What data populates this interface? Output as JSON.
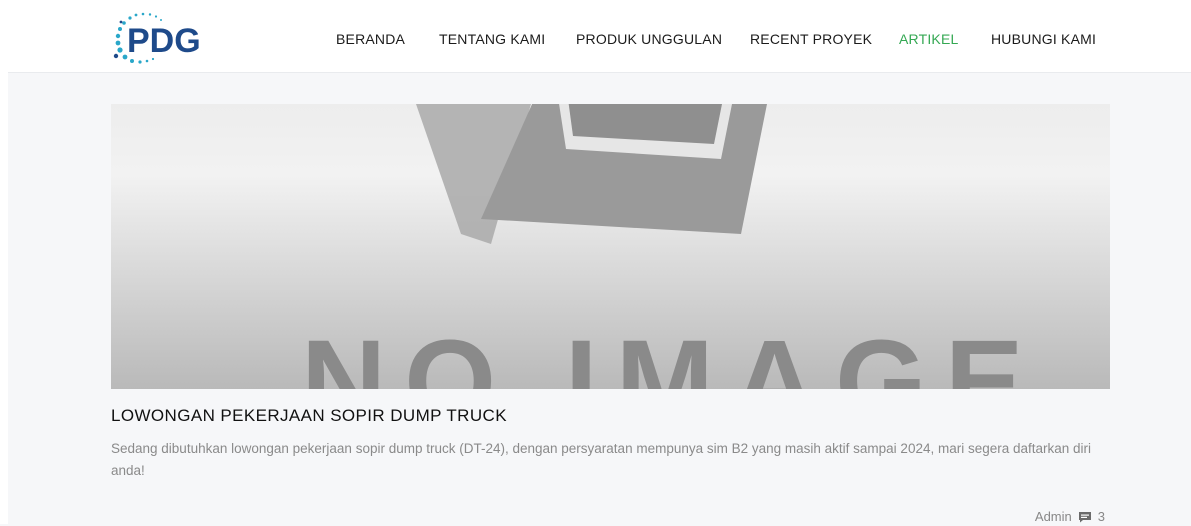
{
  "brand": {
    "logo_text": "PDG",
    "colors": {
      "primary": "#1e4a8a",
      "accent": "#34a853",
      "dots": "#2aa7c9"
    }
  },
  "nav": {
    "items": [
      {
        "label": "BERANDA",
        "active": false
      },
      {
        "label": "TENTANG KAMI",
        "active": false
      },
      {
        "label": "PRODUK UNGGULAN",
        "active": false
      },
      {
        "label": "RECENT PROYEK",
        "active": false
      },
      {
        "label": "ARTIKEL",
        "active": true
      },
      {
        "label": "HUBUNGI KAMI",
        "active": false
      }
    ]
  },
  "post": {
    "image_text": "NO IMAGE",
    "title": "LOWONGAN PEKERJAAN SOPIR DUMP TRUCK",
    "excerpt": "Sedang dibutuhkan lowongan pekerjaan sopir dump truck (DT-24), dengan persyaratan mempunya sim B2 yang masih aktif sampai 2024, mari segera daftarkan diri anda!",
    "author": "Admin",
    "comment_icon": "comment-icon",
    "comment_count": "3"
  }
}
